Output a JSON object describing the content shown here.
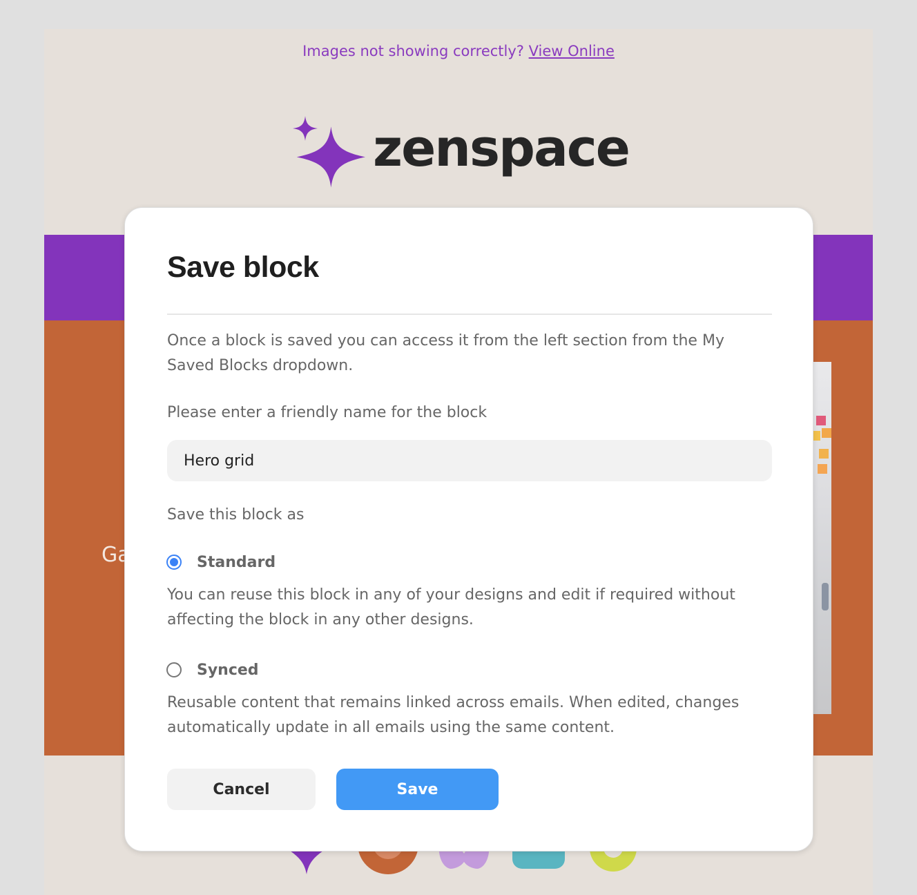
{
  "email": {
    "top_note_text": "Images not showing correctly?",
    "top_note_link": "View Online",
    "brand_name": "zenspace",
    "partial_hero_text": "Ga",
    "colors": {
      "brand_purple": "#8334bb",
      "hero_orange": "#c26537",
      "canvas_beige": "#e6e0da"
    }
  },
  "modal": {
    "title": "Save block",
    "description": "Once a block is saved you can access it from the left section from the My Saved Blocks dropdown.",
    "name_label": "Please enter a friendly name for the block",
    "name_value": "Hero grid",
    "save_as_label": "Save this block as",
    "options": [
      {
        "label": "Standard",
        "checked": true,
        "description": "You can reuse this block in any of your designs and edit if required without affecting the block in any other designs."
      },
      {
        "label": "Synced",
        "checked": false,
        "description": "Reusable content that remains linked across emails. When edited, changes automatically update in all emails using the same content."
      }
    ],
    "cancel_label": "Cancel",
    "save_label": "Save",
    "colors": {
      "primary_button": "#4299f5",
      "radio_accent": "#3b82f6"
    }
  }
}
